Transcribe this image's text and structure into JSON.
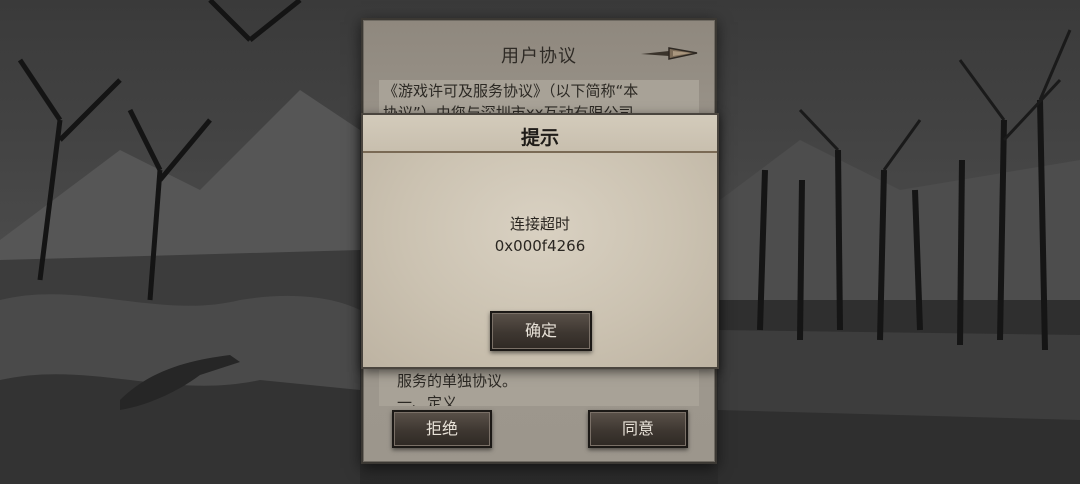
{
  "agreement": {
    "title": "用户协议",
    "text_top_line1": "《游戏许可及服务协议》（以下简称“本",
    "text_top_line2": "协议”）由您与深圳市xx互动有限公司",
    "text_bottom_line1": "服务的单独协议。",
    "text_bottom_line2": "一、定义",
    "reject_label": "拒绝",
    "agree_label": "同意"
  },
  "modal": {
    "title": "提示",
    "message": "连接超时",
    "code": "0x000f4266",
    "confirm_label": "确定"
  },
  "icons": {
    "agreement_corner": "spear-icon"
  },
  "colors": {
    "panel": "#a09a90",
    "modal": "#cbc2b1",
    "button": "#3e3731",
    "button_text": "#e8e2d8"
  }
}
